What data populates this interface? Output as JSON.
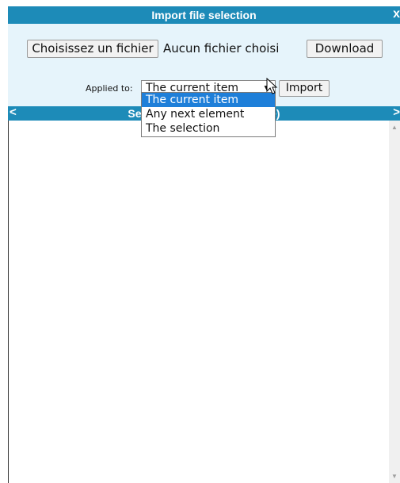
{
  "dialog": {
    "title": "Import file selection",
    "close_glyph": "x"
  },
  "file_picker": {
    "choose_label": "Choisissez un fichier",
    "status_text": "Aucun fichier choisi"
  },
  "download_label": "Download",
  "applied": {
    "label": "Applied to:",
    "selected_value": "The current item",
    "options": [
      "The current item",
      "Any next element",
      "The selection"
    ]
  },
  "import_label": "Import",
  "section": {
    "left_glyph": "<",
    "title": "Selectio                      x./page)",
    "right_glyph": ">"
  },
  "colors": {
    "titlebar": "#1d8bb8",
    "panel": "#e6f4fb",
    "option_highlight": "#1e7fd9"
  }
}
